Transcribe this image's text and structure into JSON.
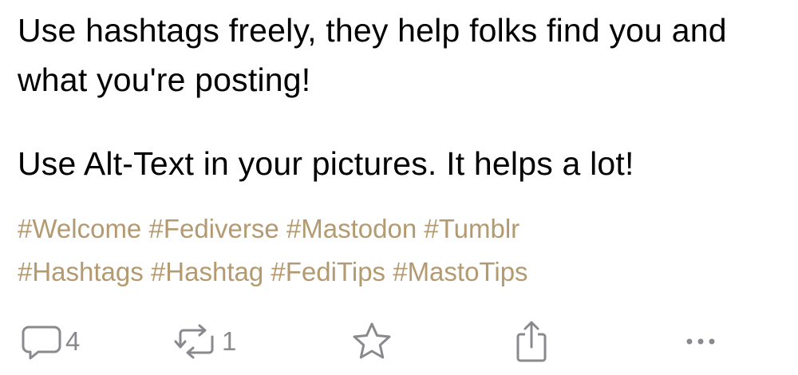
{
  "post": {
    "paragraph_1": "Use hashtags freely, they help folks find you and what you're posting!",
    "paragraph_2": "Use Alt-Text in your pictures. It helps a lot!",
    "hashtags": [
      "#Welcome",
      "#Fediverse",
      "#Mastodon",
      "#Tumblr",
      "#Hashtags",
      "#Hashtag",
      "#FediTips",
      "#MastoTips"
    ]
  },
  "actions": {
    "reply_count": "4",
    "boost_count": "1",
    "reply_icon": "speech-bubble-icon",
    "boost_icon": "boost-arrows-icon",
    "favourite_icon": "star-icon",
    "share_icon": "share-icon",
    "more_icon": "ellipsis-icon"
  },
  "colors": {
    "text": "#000000",
    "hashtag": "#b39a70",
    "icon": "#8a8a8e"
  }
}
